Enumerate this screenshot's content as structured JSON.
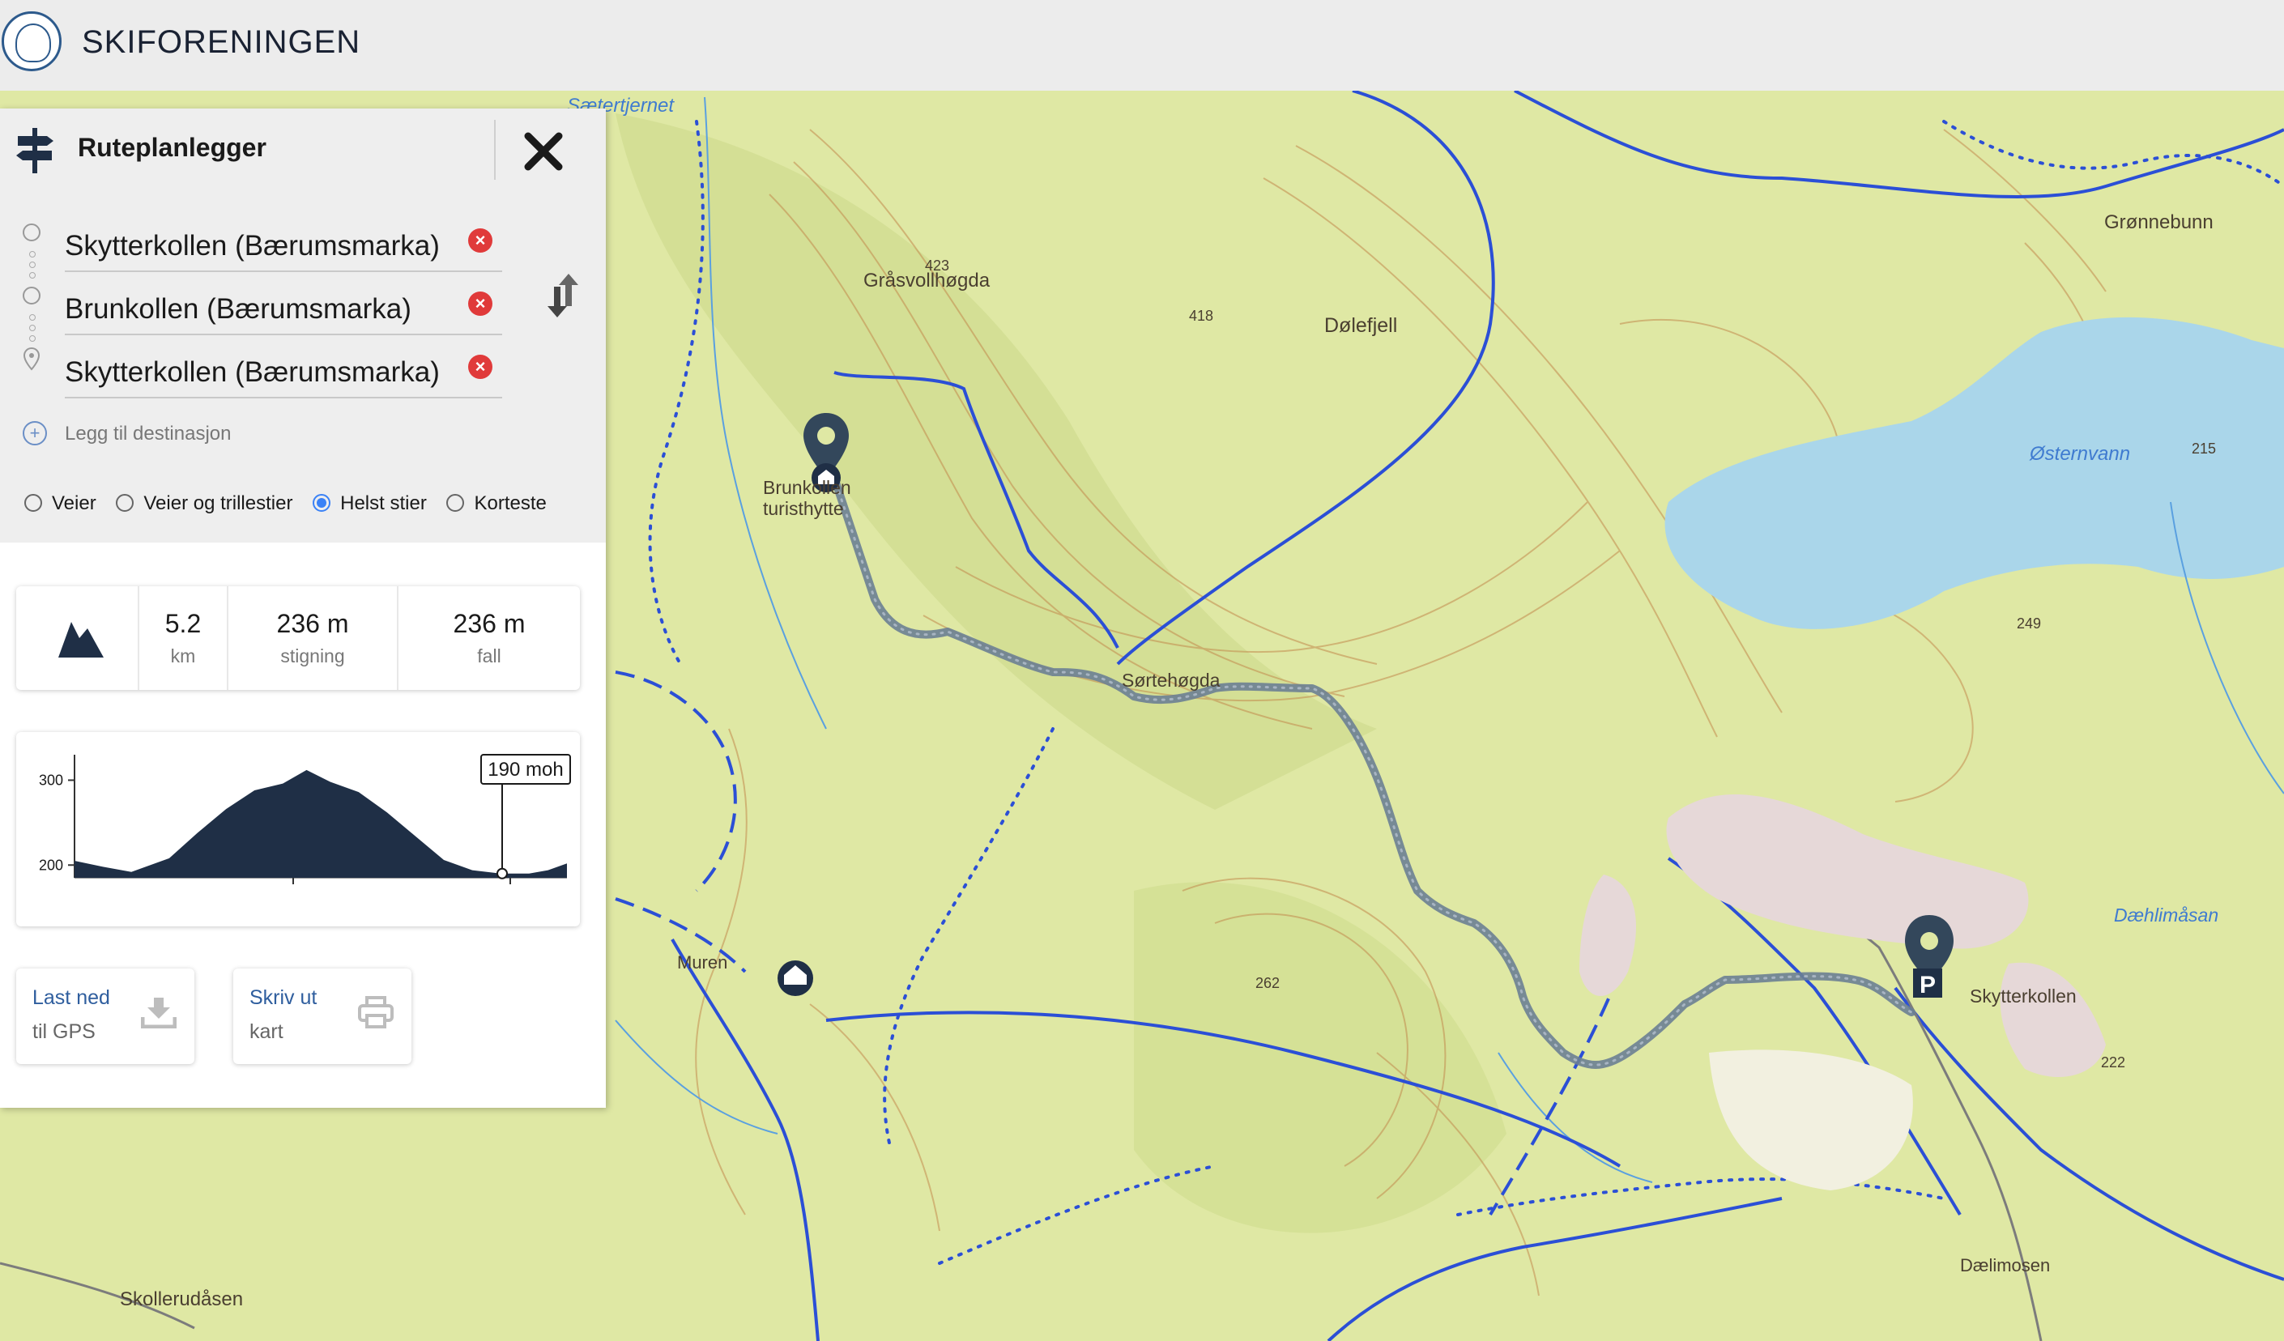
{
  "header": {
    "brand": "SKIFORENINGEN"
  },
  "panel": {
    "title": "Ruteplanlegger",
    "destinations": [
      {
        "label": "Skytterkollen (Bærumsmarka)"
      },
      {
        "label": "Brunkollen (Bærumsmarka)"
      },
      {
        "label": "Skytterkollen (Bærumsmarka)"
      }
    ],
    "add_destination": "Legg til destinasjon",
    "route_options": [
      {
        "label": "Veier",
        "selected": false
      },
      {
        "label": "Veier og trillestier",
        "selected": false
      },
      {
        "label": "Helst stier",
        "selected": true
      },
      {
        "label": "Korteste",
        "selected": false
      }
    ],
    "stats": {
      "distance": "5.2",
      "distance_unit": "km",
      "climb": "236 m",
      "climb_label": "stigning",
      "descent": "236 m",
      "descent_label": "fall"
    },
    "profile": {
      "tooltip": "190 moh",
      "y_ticks": [
        "300",
        "200"
      ]
    },
    "gps_button": {
      "line1": "Last ned",
      "line2": "til GPS"
    },
    "print_button": {
      "line1": "Skriv ut",
      "line2": "kart"
    }
  },
  "chart_data": {
    "type": "area",
    "x": [
      0,
      0.3,
      0.6,
      1.0,
      1.3,
      1.6,
      1.9,
      2.2,
      2.45,
      2.7,
      3.0,
      3.3,
      3.6,
      3.9,
      4.2,
      4.5,
      4.8,
      5.0,
      5.2
    ],
    "values": [
      205,
      198,
      192,
      208,
      238,
      266,
      288,
      296,
      312,
      298,
      286,
      262,
      234,
      206,
      194,
      190,
      190,
      194,
      202
    ],
    "y_ticks": [
      300,
      200
    ],
    "ylim": [
      185,
      330
    ],
    "marker_value": 190
  },
  "map_labels": [
    {
      "text": "Sætertjernet"
    },
    {
      "text": "Grønnebunn"
    },
    {
      "text": "Gråsvollhøgda"
    },
    {
      "text": "Dølefjell"
    },
    {
      "text": "Østernvann"
    },
    {
      "text": "Brunkollen"
    },
    {
      "text": "turisthytte"
    },
    {
      "text": "Sørtehøgda"
    },
    {
      "text": "Dæhlimåsan"
    },
    {
      "text": "Skytterkollen"
    },
    {
      "text": "Muren"
    },
    {
      "text": "Skollerudåsen"
    },
    {
      "text": "Dælimosen"
    },
    {
      "text": "423"
    },
    {
      "text": "418"
    },
    {
      "text": "215"
    },
    {
      "text": "249"
    },
    {
      "text": "262"
    },
    {
      "text": "222"
    }
  ],
  "colors": {
    "route": "#6b7f93",
    "trail": "#2b4fd6",
    "panel_bg": "#eeeeee",
    "link": "#2f5e9e"
  }
}
